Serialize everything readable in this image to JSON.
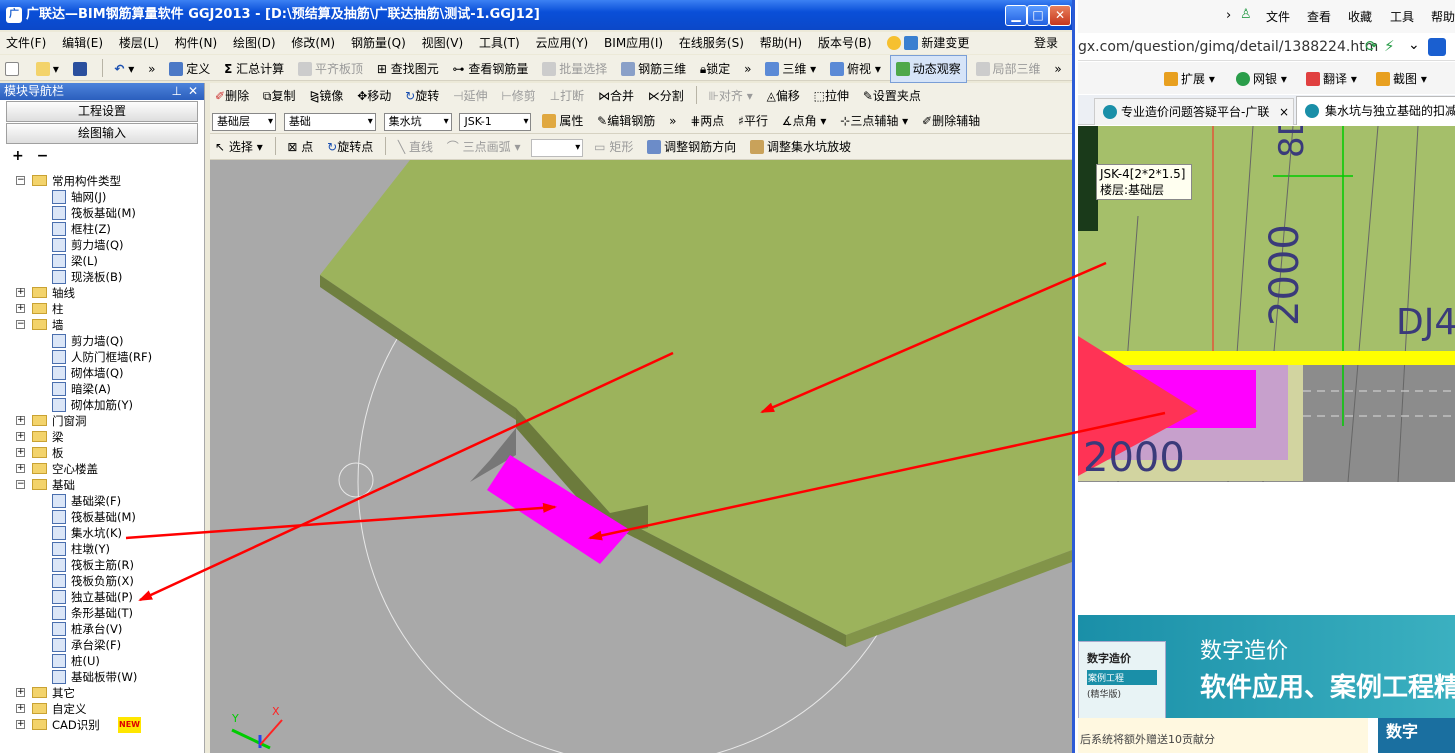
{
  "app": {
    "title": "广联达—BIM钢筋算量软件 GGJ2013 - [D:\\预结算及抽筋\\广联达抽筋\\测试-1.GGJ12]",
    "menu": [
      "文件(F)",
      "编辑(E)",
      "楼层(L)",
      "构件(N)",
      "绘图(D)",
      "修改(M)",
      "钢筋量(Q)",
      "视图(V)",
      "工具(T)",
      "云应用(Y)",
      "BIM应用(I)",
      "在线服务(S)",
      "帮助(H)",
      "版本号(B)"
    ],
    "new_change": "新建变更",
    "login": "登录",
    "toolbar1": [
      "定义",
      "汇总计算",
      "平齐板顶",
      "查找图元",
      "查看钢筋量",
      "批量选择",
      "钢筋三维",
      "锁定",
      "三维",
      "俯视",
      "动态观察",
      "局部三维"
    ],
    "toolbar2": [
      "删除",
      "复制",
      "镜像",
      "移动",
      "旋转",
      "延伸",
      "修剪",
      "打断",
      "合并",
      "分割",
      "对齐",
      "偏移",
      "拉伸",
      "设置夹点"
    ],
    "toolbar3": {
      "floor": "基础层",
      "category": "基础",
      "type": "集水坑",
      "component": "JSK-1",
      "buttons": [
        "属性",
        "编辑钢筋",
        "两点",
        "平行",
        "点角",
        "三点辅轴",
        "删除辅轴"
      ]
    },
    "toolbar4": [
      "选择",
      "点",
      "旋转点",
      "直线",
      "三点画弧",
      "矩形",
      "调整钢筋方向",
      "调整集水坑放坡"
    ]
  },
  "nav": {
    "title": "模块导航栏",
    "btn_project": "工程设置",
    "btn_draw": "绘图输入",
    "tree": [
      {
        "level": 0,
        "label": "常用构件类型",
        "expanded": true
      },
      {
        "level": 1,
        "label": "轴网(J)"
      },
      {
        "level": 1,
        "label": "筏板基础(M)"
      },
      {
        "level": 1,
        "label": "框柱(Z)"
      },
      {
        "level": 1,
        "label": "剪力墙(Q)"
      },
      {
        "level": 1,
        "label": "梁(L)"
      },
      {
        "level": 1,
        "label": "现浇板(B)"
      },
      {
        "level": 0,
        "label": "轴线",
        "expanded": false
      },
      {
        "level": 0,
        "label": "柱",
        "expanded": false
      },
      {
        "level": 0,
        "label": "墙",
        "expanded": true
      },
      {
        "level": 1,
        "label": "剪力墙(Q)"
      },
      {
        "level": 1,
        "label": "人防门框墙(RF)"
      },
      {
        "level": 1,
        "label": "砌体墙(Q)"
      },
      {
        "level": 1,
        "label": "暗梁(A)"
      },
      {
        "level": 1,
        "label": "砌体加筋(Y)"
      },
      {
        "level": 0,
        "label": "门窗洞",
        "expanded": false
      },
      {
        "level": 0,
        "label": "梁",
        "expanded": false
      },
      {
        "level": 0,
        "label": "板",
        "expanded": false
      },
      {
        "level": 0,
        "label": "空心楼盖",
        "expanded": false
      },
      {
        "level": 0,
        "label": "基础",
        "expanded": true
      },
      {
        "level": 1,
        "label": "基础梁(F)"
      },
      {
        "level": 1,
        "label": "筏板基础(M)"
      },
      {
        "level": 1,
        "label": "集水坑(K)"
      },
      {
        "level": 1,
        "label": "柱墩(Y)"
      },
      {
        "level": 1,
        "label": "筏板主筋(R)"
      },
      {
        "level": 1,
        "label": "筏板负筋(X)"
      },
      {
        "level": 1,
        "label": "独立基础(P)"
      },
      {
        "level": 1,
        "label": "条形基础(T)"
      },
      {
        "level": 1,
        "label": "桩承台(V)"
      },
      {
        "level": 1,
        "label": "承台梁(F)"
      },
      {
        "level": 1,
        "label": "桩(U)"
      },
      {
        "level": 1,
        "label": "基础板带(W)"
      },
      {
        "level": 0,
        "label": "其它",
        "expanded": false
      },
      {
        "level": 0,
        "label": "自定义",
        "expanded": false
      },
      {
        "level": 0,
        "label": "CAD识别",
        "expanded": false,
        "badge": "NEW"
      }
    ]
  },
  "browser": {
    "menu": [
      "文件",
      "查看",
      "收藏",
      "工具",
      "帮助"
    ],
    "url": "gx.com/question/gimq/detail/1388224.htm",
    "ext": [
      "扩展",
      "网银",
      "翻译",
      "截图"
    ],
    "tabs": [
      "专业造价问题答疑平台-广联",
      "集水坑与独立基础的扣减"
    ],
    "tooltip_line1": "JSK-4[2*2*1.5]",
    "tooltip_line2": "楼层:基础层",
    "dim_vertical_1": "8D",
    "dim_vertical_2": "2000",
    "dim_horizontal": "2000",
    "dj_label": "DJ4",
    "banner_title": "数字造价",
    "banner_sub": "软件应用、案例工程精",
    "book_title": "数字造价",
    "book_badge1": "案例工程",
    "book_badge2": "(精华版)",
    "book2_title": "数字",
    "footer_text": "后系统将额外赠送10贡献分"
  },
  "colors": {
    "plate": "#9cb35c",
    "plate_dark": "#6f7f3f",
    "pit": "#ff00ff",
    "arrow": "#ff0000",
    "viewport_bg": "#a9a9a9",
    "browser_accent": "#1a8fa8"
  }
}
